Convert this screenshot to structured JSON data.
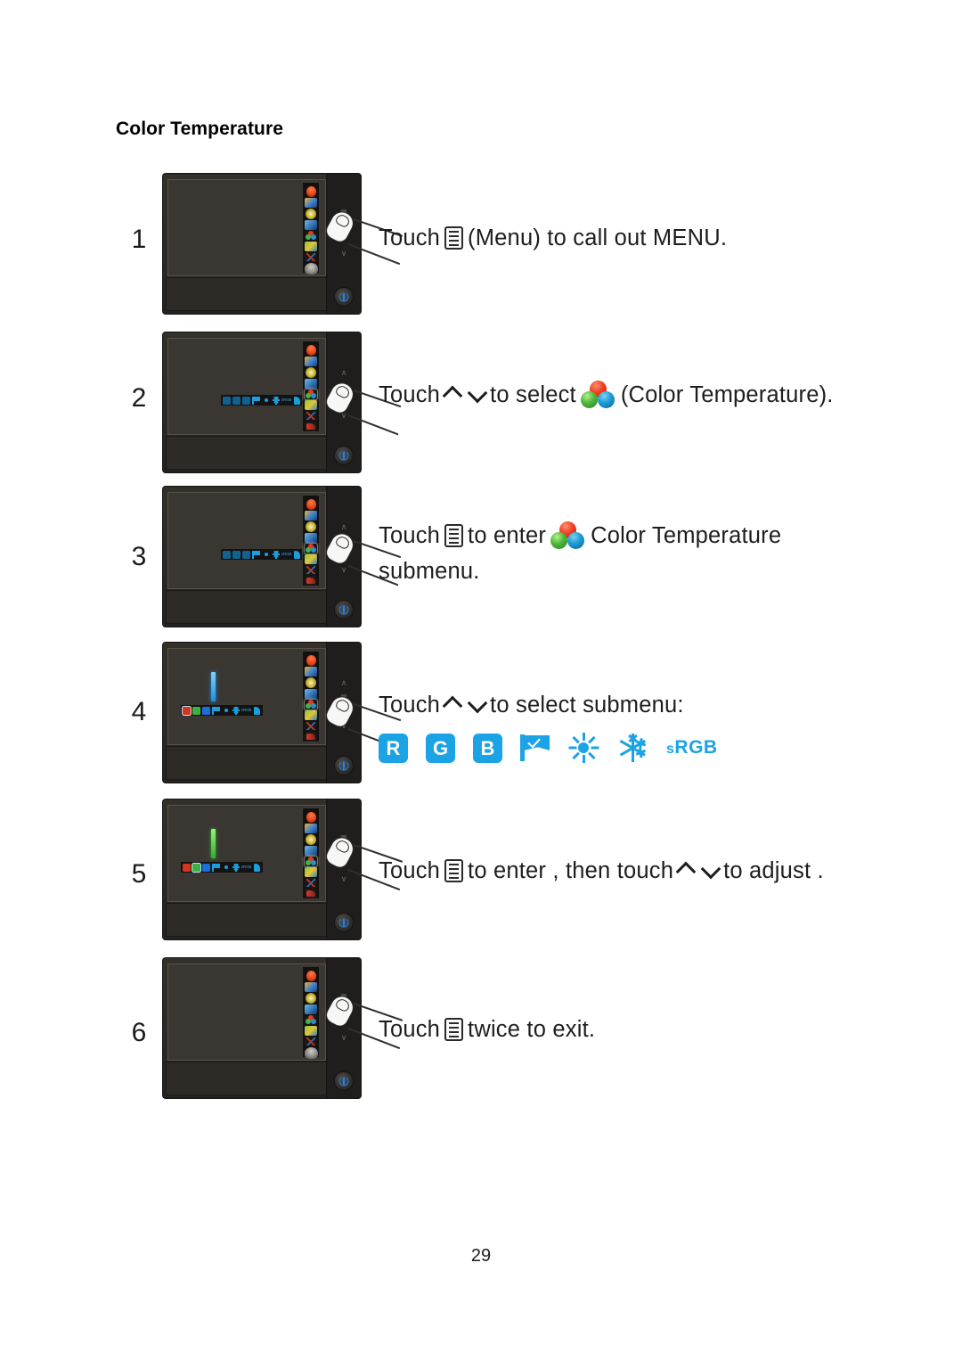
{
  "document": {
    "section_title": "Color Temperature",
    "page_number": "29"
  },
  "icons": {
    "menu": "menu-icon",
    "arrow_up": "chevron-up-icon",
    "arrow_down": "chevron-down-icon",
    "rgb_spheres": "color-temperature-rgb-spheres-icon",
    "power": "power-icon",
    "finger": "touch-finger-icon"
  },
  "colors": {
    "submenu_cyan": "#1ba3e6",
    "red": "#d8331f",
    "green": "#3cb043",
    "blue": "#1b6fd8",
    "monitor_body": "#2a2724",
    "screen": "#3a3733"
  },
  "steps": [
    {
      "number": "1",
      "text_before": "Touch",
      "text_after": "(Menu) to  call out MENU.",
      "has_menu_icon": true,
      "has_arrows": false,
      "has_rgb_icon": false,
      "screen_state": "menu-strip-only"
    },
    {
      "number": "2",
      "text_before": "Touch",
      "text_mid": "to select",
      "text_after": "(Color  Temperature).",
      "has_menu_icon": false,
      "has_arrows": true,
      "has_rgb_icon": true,
      "screen_state": "submenu-bar-dim"
    },
    {
      "number": "3",
      "text_before": "Touch",
      "text_mid": "to enter",
      "text_after": "Color  Temperature",
      "text_line2": "submenu.",
      "has_menu_icon": true,
      "has_arrows": false,
      "has_rgb_icon": true,
      "screen_state": "submenu-bar-dim"
    },
    {
      "number": "4",
      "text_before": "Touch",
      "text_mid": "to select submenu:",
      "text_after": "",
      "has_menu_icon": false,
      "has_arrows": true,
      "has_rgb_icon": false,
      "screen_state": "submenu-bar-rgb-blue-slider"
    },
    {
      "number": "5",
      "text_before": "Touch",
      "text_mid": "to enter , then touch",
      "text_after": "to  adjust .",
      "has_menu_icon": true,
      "has_arrows": true,
      "has_rgb_icon": false,
      "screen_state": "submenu-bar-rgb-green-slider"
    },
    {
      "number": "6",
      "text_before": "Touch",
      "text_after": "twice to exit.",
      "has_menu_icon": true,
      "has_arrows": false,
      "has_rgb_icon": false,
      "screen_state": "menu-strip-only"
    }
  ],
  "submenu_options": [
    {
      "name": "red-option",
      "label": "R",
      "kind": "square"
    },
    {
      "name": "green-option",
      "label": "G",
      "kind": "square"
    },
    {
      "name": "blue-option",
      "label": "B",
      "kind": "square"
    },
    {
      "name": "user-preset-option",
      "label": "",
      "kind": "flag"
    },
    {
      "name": "warm-option",
      "label": "",
      "kind": "sun"
    },
    {
      "name": "cool-option",
      "label": "",
      "kind": "snowflake"
    },
    {
      "name": "srgb-option",
      "label": "sRGB",
      "kind": "text"
    }
  ],
  "osd_main_menu": [
    {
      "name": "luminance-menu-icon"
    },
    {
      "name": "image-setup-menu-icon"
    },
    {
      "name": "color-setup-menu-icon"
    },
    {
      "name": "osd-setup-menu-icon"
    },
    {
      "name": "color-temperature-menu-icon"
    },
    {
      "name": "picture-boost-menu-icon"
    },
    {
      "name": "extra-menu-icon"
    },
    {
      "name": "exit-menu-icon"
    }
  ],
  "monitor_controls": {
    "up_label": "∧",
    "down_label": "∨"
  }
}
